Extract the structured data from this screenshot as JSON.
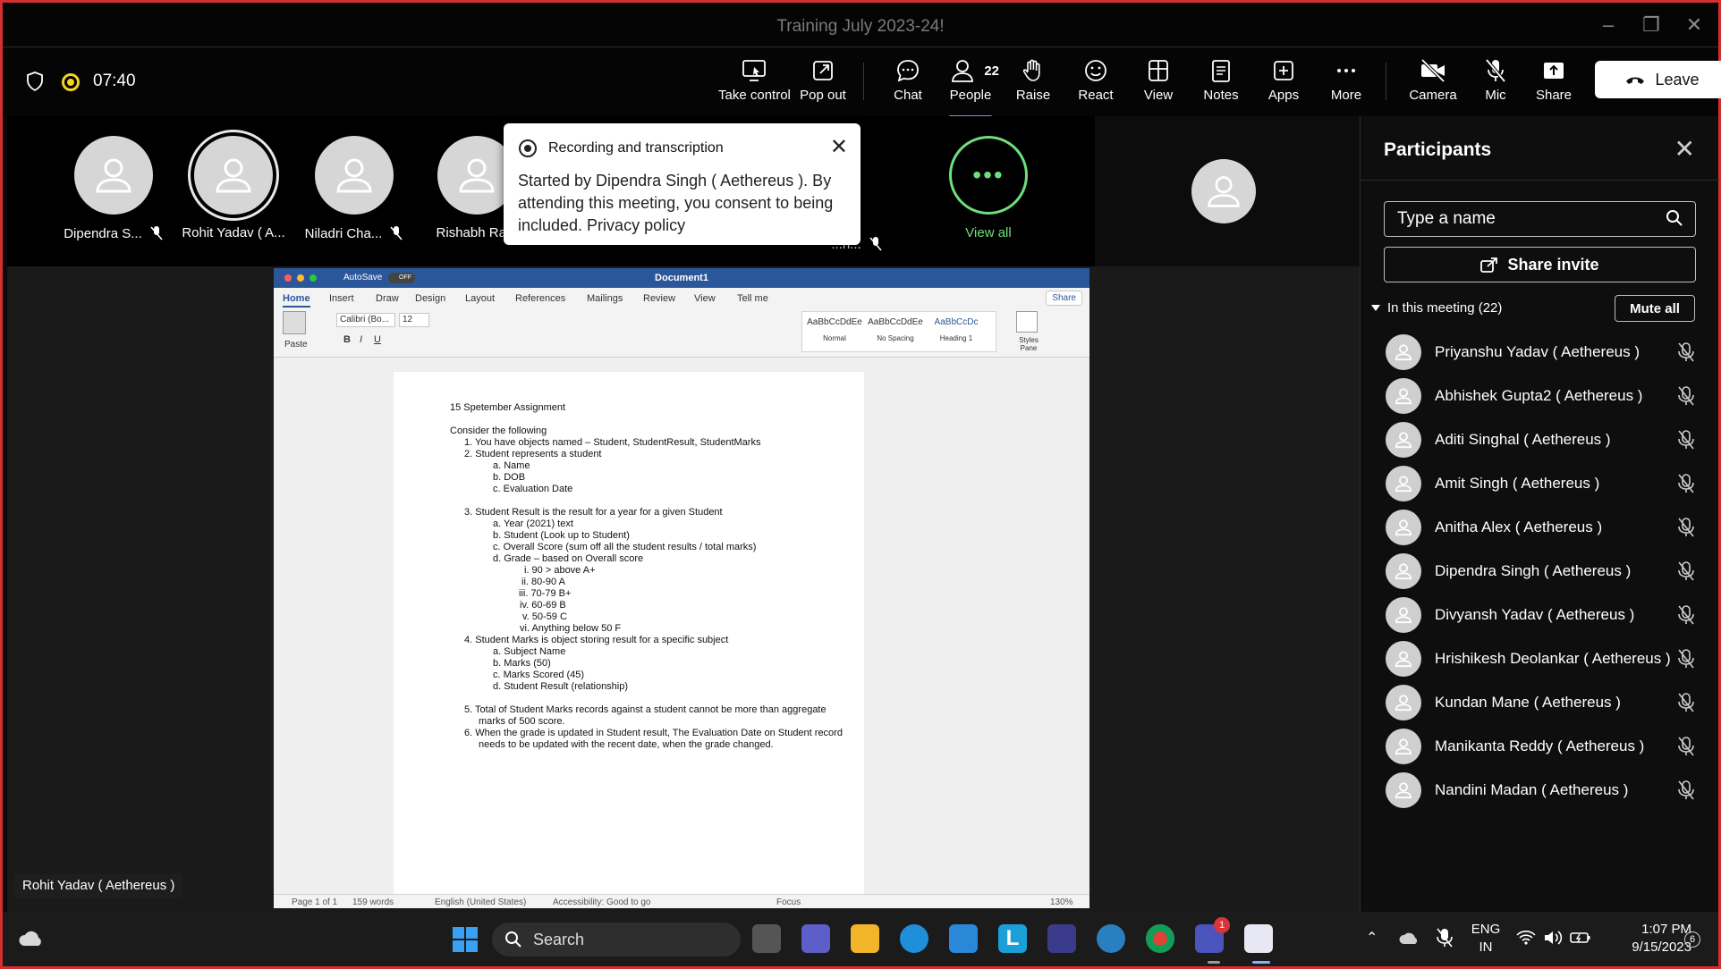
{
  "window": {
    "title": "Training July 2023-24!"
  },
  "toolbar": {
    "time": "07:40",
    "take_control": "Take control",
    "pop_out": "Pop out",
    "chat": "Chat",
    "people": "People",
    "people_count": "22",
    "raise": "Raise",
    "react": "React",
    "view": "View",
    "notes": "Notes",
    "apps": "Apps",
    "more": "More",
    "camera": "Camera",
    "mic": "Mic",
    "share": "Share",
    "leave": "Leave",
    "accent_color": "#7e8cf0"
  },
  "strip": {
    "tiles": [
      "Dipendra S...",
      "Rohit Yadav ( A...",
      "Niladri Cha...",
      "Rishabh Ra...",
      "...h..."
    ],
    "view_all": "View all"
  },
  "popup": {
    "title": "Recording and transcription",
    "body": "Started by Dipendra Singh ( Aethereus ). By attending this meeting, you consent to being included. Privacy policy"
  },
  "presenter_tag": "Rohit Yadav ( Aethereus )",
  "word": {
    "autosave": "AutoSave",
    "autosave_state": "OFF",
    "doc_title": "Document1",
    "tabs": [
      "Home",
      "Insert",
      "Draw",
      "Design",
      "Layout",
      "References",
      "Mailings",
      "Review",
      "View"
    ],
    "tell_me": "Tell me",
    "share": "Share",
    "paste": "Paste",
    "font": "Calibri (Bo...",
    "size": "12",
    "styles": [
      {
        "sample": "AaBbCcDdEe",
        "name": "Normal"
      },
      {
        "sample": "AaBbCcDdEe",
        "name": "No Spacing"
      },
      {
        "sample": "AaBbCcDc",
        "name": "Heading 1"
      }
    ],
    "styles_pane": "Styles Pane",
    "lines": [
      "15 Spetember Assignment",
      "Consider the following",
      "1.   You have objects named – Student, StudentResult, StudentMarks",
      "2.   Student represents a student",
      "a.   Name",
      "b.   DOB",
      "c.   Evaluation Date",
      "3.   Student Result is the result for a year for a given Student",
      "a.   Year (2021) text",
      "b.   Student (Look up to Student)",
      "c.   Overall Score (sum off all the student results / total marks)",
      "d.    Grade – based on Overall score",
      "i.    90 > above A+",
      "ii.    80-90 A",
      "iii.    70-79 B+",
      "iv.    60-69 B",
      "v.    50-59 C",
      "vi.    Anything below 50 F",
      "4.   Student Marks is object storing result for a specific subject",
      "a.   Subject Name",
      "b.   Marks (50)",
      "c.   Marks Scored (45)",
      "d.   Student Result (relationship)",
      "5.   Total of Student Marks records against a student cannot be more than aggregate",
      "marks of 500 score.",
      "6.   When the grade is updated in Student result, The Evaluation Date on Student record",
      "needs to be updated with the recent date, when the grade changed."
    ],
    "status": {
      "page": "Page 1 of 1",
      "words": "159 words",
      "language": "English (United States)",
      "accessibility": "Accessibility: Good to go",
      "focus": "Focus",
      "zoom": "130%"
    }
  },
  "participants": {
    "title": "Participants",
    "search_placeholder": "Type a name",
    "share_invite": "Share invite",
    "section": "In this meeting (22)",
    "mute_all": "Mute all",
    "people": [
      "Priyanshu Yadav ( Aethereus )",
      "Abhishek Gupta2 ( Aethereus )",
      "Aditi Singhal ( Aethereus )",
      "Amit Singh ( Aethereus )",
      "Anitha Alex ( Aethereus )",
      "Dipendra Singh ( Aethereus )",
      "Divyansh Yadav ( Aethereus )",
      "Hrishikesh Deolankar ( Aethereus )",
      "Kundan Mane ( Aethereus )",
      "Manikanta Reddy ( Aethereus )",
      "Nandini Madan ( Aethereus )"
    ]
  },
  "taskbar": {
    "search": "Search",
    "lang1": "ENG",
    "lang2": "IN",
    "time": "1:07 PM",
    "date": "9/15/2023",
    "teams_badge": "1",
    "notif_badge": "6"
  }
}
